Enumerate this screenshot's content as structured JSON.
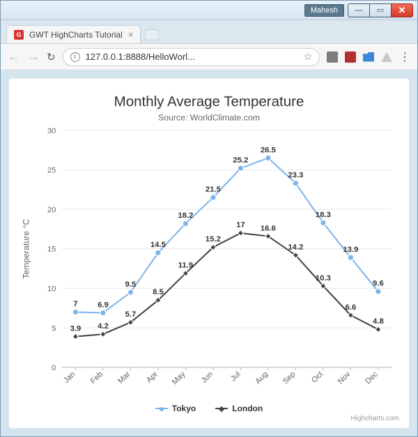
{
  "titlebar": {
    "user": "Mahesh"
  },
  "tab": {
    "title": "GWT HighCharts Tutorial"
  },
  "toolbar": {
    "url": "127.0.0.1:8888/HelloWorl..."
  },
  "chart_data": {
    "type": "line",
    "title": "Monthly Average Temperature",
    "subtitle": "Source: WorldClimate.com",
    "ylabel": "Temperature °C",
    "xlabel": "",
    "categories": [
      "Jan",
      "Feb",
      "Mar",
      "Apr",
      "May",
      "Jun",
      "Jul",
      "Aug",
      "Sep",
      "Oct",
      "Nov",
      "Dec"
    ],
    "ylim": [
      0,
      30
    ],
    "yticks": [
      0,
      5,
      10,
      15,
      20,
      25,
      30
    ],
    "series": [
      {
        "name": "Tokyo",
        "color": "#7cb5ec",
        "marker": "circle",
        "values": [
          7,
          6.9,
          9.5,
          14.5,
          18.2,
          21.5,
          25.2,
          26.5,
          23.3,
          18.3,
          13.9,
          9.6
        ]
      },
      {
        "name": "London",
        "color": "#434348",
        "marker": "diamond",
        "values": [
          3.9,
          4.2,
          5.7,
          8.5,
          11.9,
          15.2,
          17,
          16.6,
          14.2,
          10.3,
          6.6,
          4.8
        ]
      }
    ],
    "credits": "Highcharts.com"
  }
}
